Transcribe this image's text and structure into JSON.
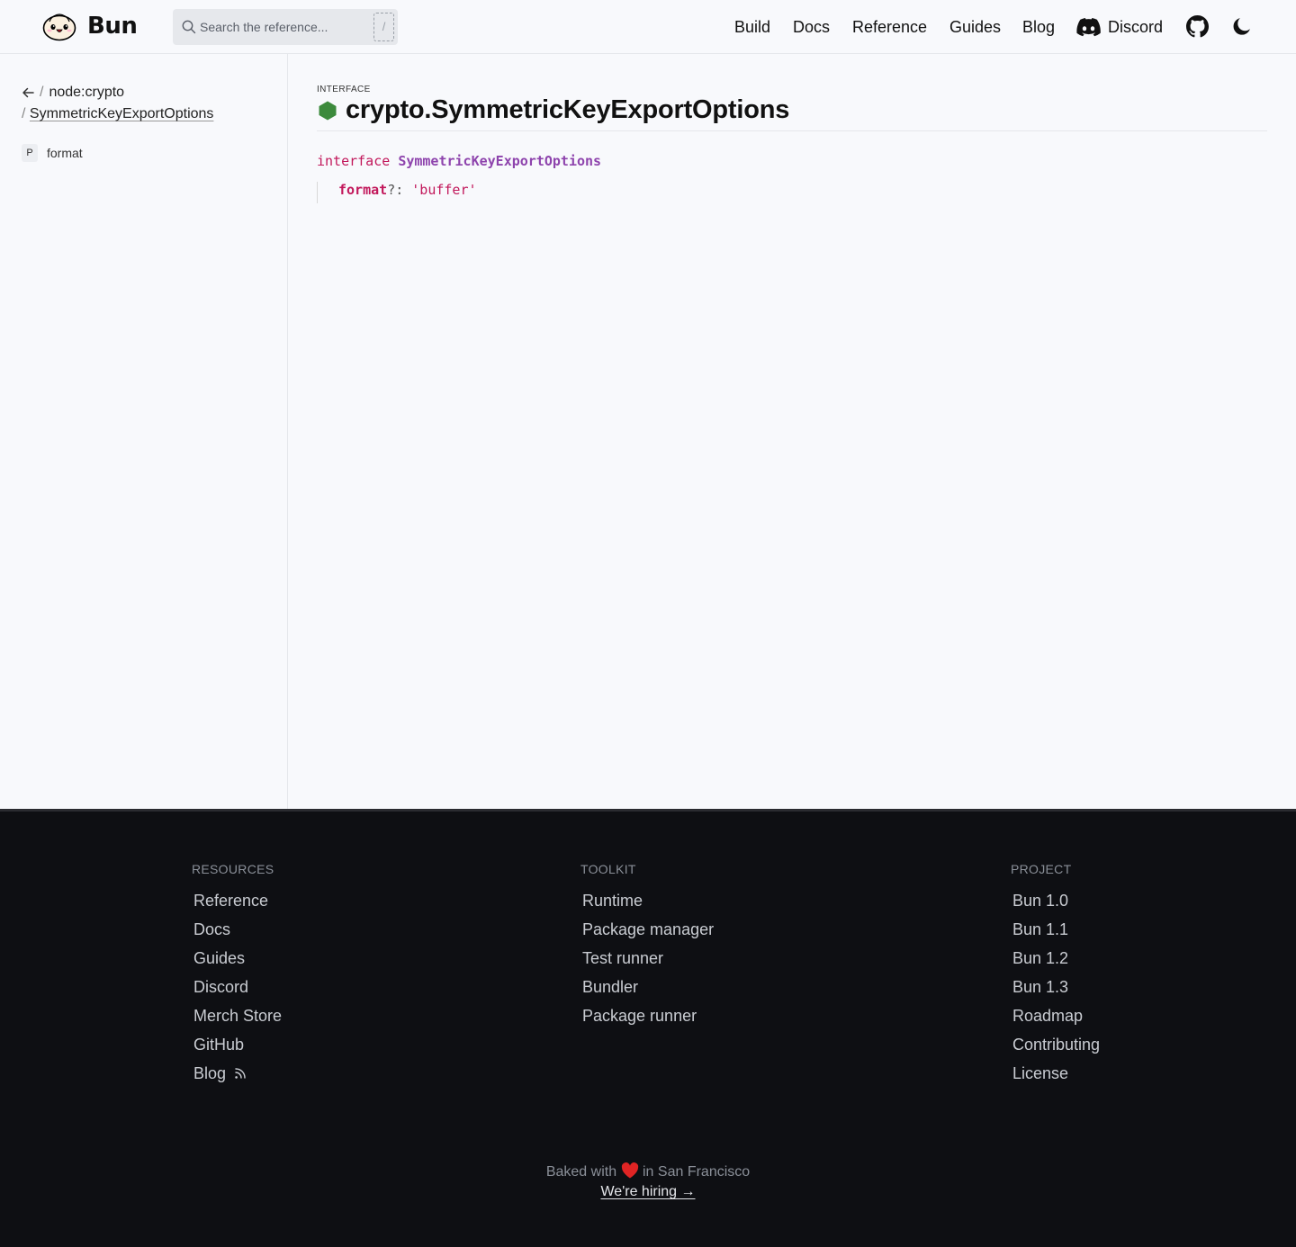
{
  "header": {
    "logo_text": "Bun",
    "search_placeholder": "Search the reference...",
    "search_shortcut": "/",
    "nav": {
      "build": "Build",
      "docs": "Docs",
      "reference": "Reference",
      "guides": "Guides",
      "blog": "Blog",
      "discord": "Discord"
    },
    "icons": [
      "bun-logo-icon",
      "search-icon",
      "discord-icon",
      "github-icon",
      "moon-icon"
    ]
  },
  "sidebar": {
    "back_icon": "arrow-left-icon",
    "separator": "/",
    "parent": "node:crypto",
    "current": "SymmetricKeyExportOptions",
    "items": [
      {
        "badge": "P",
        "label": "format"
      }
    ]
  },
  "main": {
    "kind": "INTERFACE",
    "title": "crypto.SymmetricKeyExportOptions",
    "title_icon": "hexagon-icon",
    "title_icon_color": "#3c8a3c",
    "code": {
      "keyword": "interface",
      "name": "SymmetricKeyExportOptions",
      "prop_name": "format",
      "prop_punct": "?: ",
      "prop_type": "'buffer'"
    }
  },
  "footer": {
    "columns": [
      {
        "heading": "RESOURCES",
        "links": [
          "Reference",
          "Docs",
          "Guides",
          "Discord",
          "Merch Store",
          "GitHub",
          "Blog"
        ]
      },
      {
        "heading": "TOOLKIT",
        "links": [
          "Runtime",
          "Package manager",
          "Test runner",
          "Bundler",
          "Package runner"
        ]
      },
      {
        "heading": "PROJECT",
        "links": [
          "Bun 1.0",
          "Bun 1.1",
          "Bun 1.2",
          "Bun 1.3",
          "Roadmap",
          "Contributing",
          "License"
        ]
      }
    ],
    "baked_before": "Baked with",
    "baked_after": "in San Francisco",
    "hiring": "We're hiring →",
    "colors": {
      "background": "#0e0f13",
      "heart": "#e02424"
    }
  }
}
